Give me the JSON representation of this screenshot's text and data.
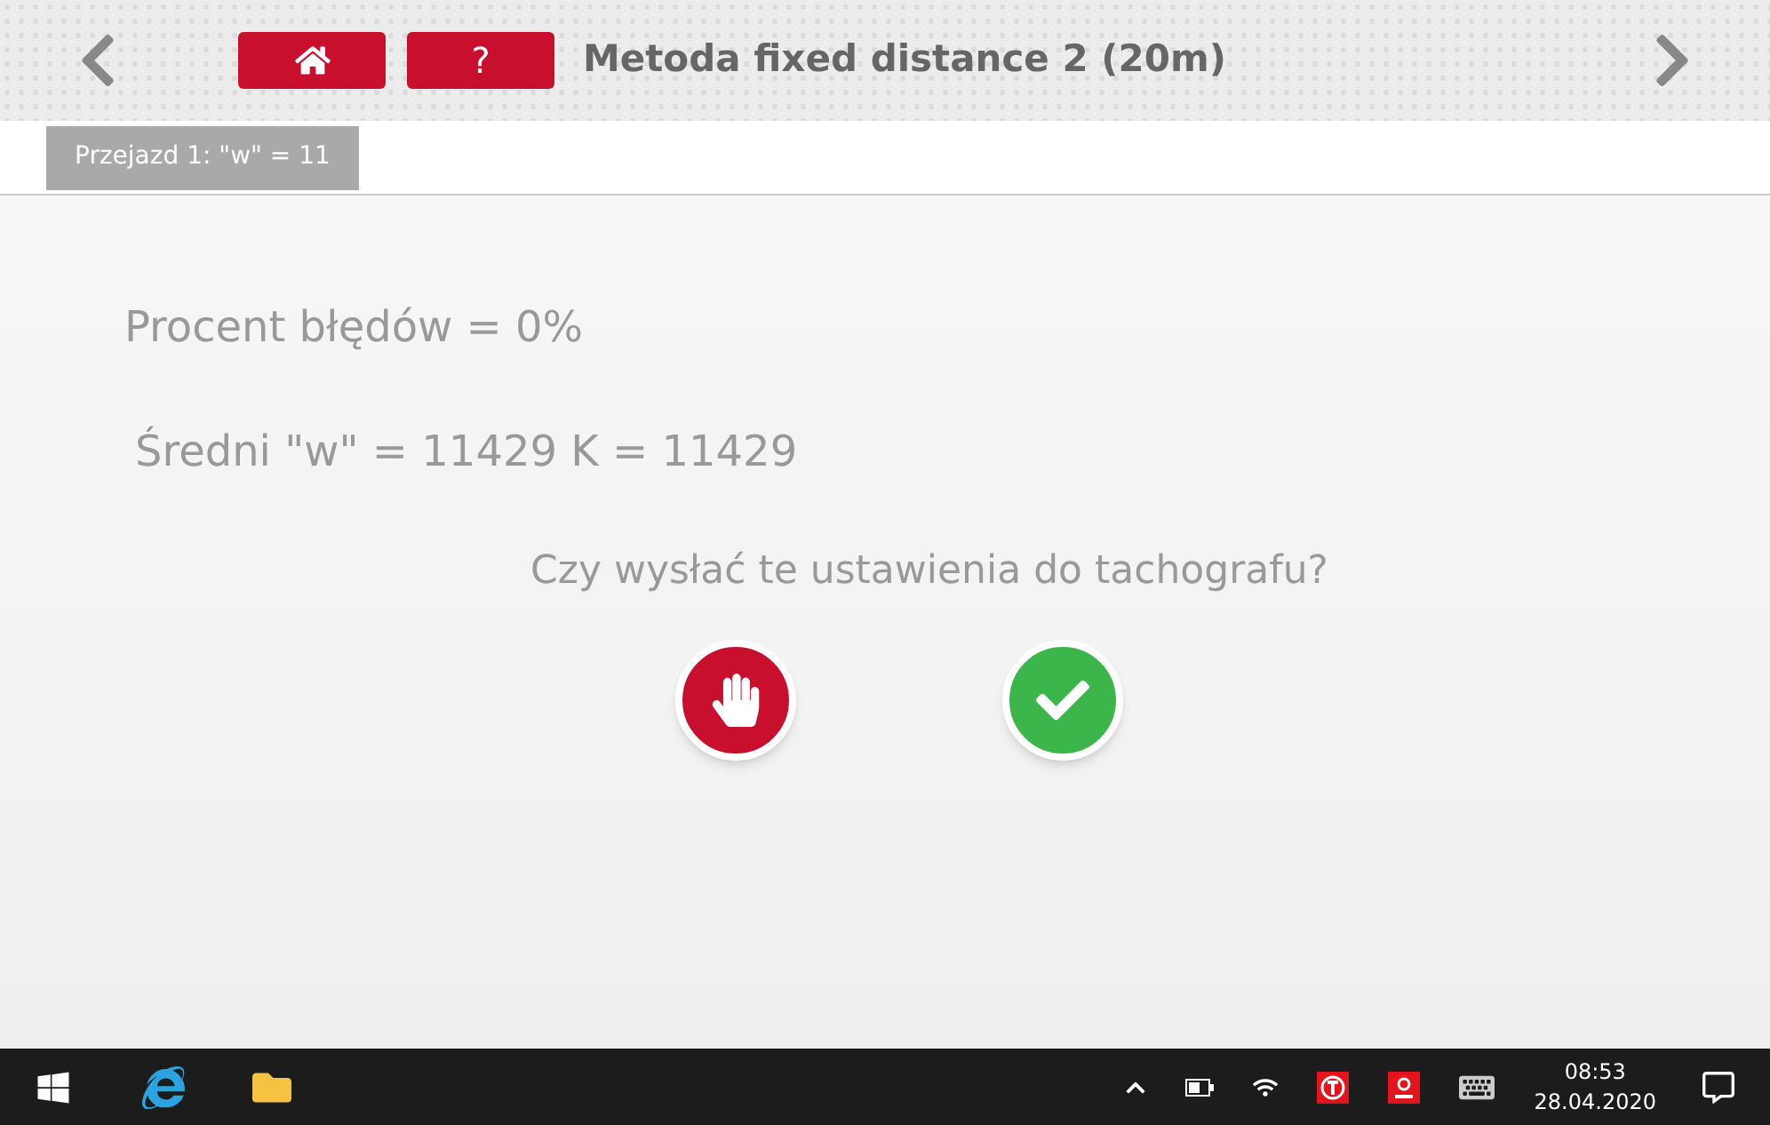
{
  "header": {
    "help_label": "?",
    "title": "Metoda fixed distance 2 (20m)"
  },
  "tabs": [
    {
      "label": "Przejazd 1: \"w\" = 11",
      "selected": true
    }
  ],
  "results": {
    "error_rate": "Procent błędów = 0%",
    "average": "Średni \"w\" = 11429 K = 11429",
    "question": "Czy wysłać te ustawienia do tachografu?"
  },
  "taskbar": {
    "time": "08:53",
    "date": "28.04.2020"
  }
}
